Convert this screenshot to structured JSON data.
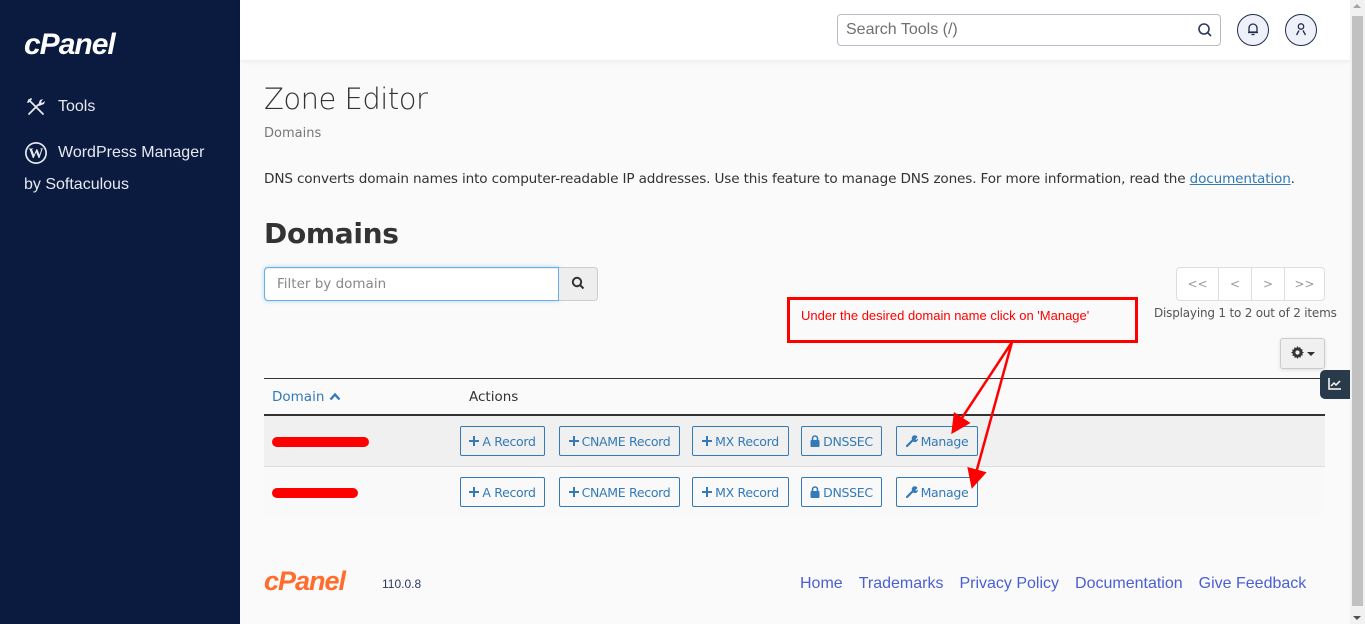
{
  "sidebar": {
    "logo_text": "cPanel",
    "items": [
      {
        "label": "Tools",
        "icon": "tools-icon"
      },
      {
        "label": "WordPress Manager",
        "sublabel": "by Softaculous",
        "icon": "wordpress-icon"
      }
    ]
  },
  "header": {
    "search": {
      "placeholder": "Search Tools (/)",
      "value": ""
    },
    "notifications_icon": "bell-icon",
    "user_icon": "user-icon"
  },
  "page": {
    "title": "Zone Editor",
    "breadcrumb": "Domains",
    "description_prefix": "DNS converts domain names into computer-readable IP addresses. Use this feature to manage DNS zones. For more information, read the ",
    "description_link": "documentation",
    "description_suffix": "."
  },
  "domains_section": {
    "title": "Domains",
    "filter": {
      "placeholder": "Filter by domain",
      "value": ""
    },
    "pagination": {
      "first": "<<",
      "prev": "<",
      "next": ">",
      "last": ">>",
      "status": "Displaying 1 to 2 out of 2 items"
    },
    "table": {
      "columns": [
        "Domain",
        "Actions"
      ],
      "sort_column": "Domain",
      "sort_direction": "ascending",
      "action_labels": {
        "a_record": "A Record",
        "cname_record": "CNAME Record",
        "mx_record": "MX Record",
        "dnssec": "DNSSEC",
        "manage": "Manage"
      },
      "rows": [
        {
          "domain": "[redacted]"
        },
        {
          "domain": "[redacted]"
        }
      ]
    }
  },
  "annotation": {
    "text": "Under the desired domain name click on 'Manage'",
    "color": "#ff0000"
  },
  "footer": {
    "logo_text": "cPanel",
    "version": "110.0.8",
    "links": [
      "Home",
      "Trademarks",
      "Privacy Policy",
      "Documentation",
      "Give Feedback"
    ]
  },
  "colors": {
    "sidebar_bg": "#0b1b3f",
    "link": "#337ab7",
    "footer_logo": "#ff6c2c",
    "footer_link": "#4a5fd4"
  }
}
